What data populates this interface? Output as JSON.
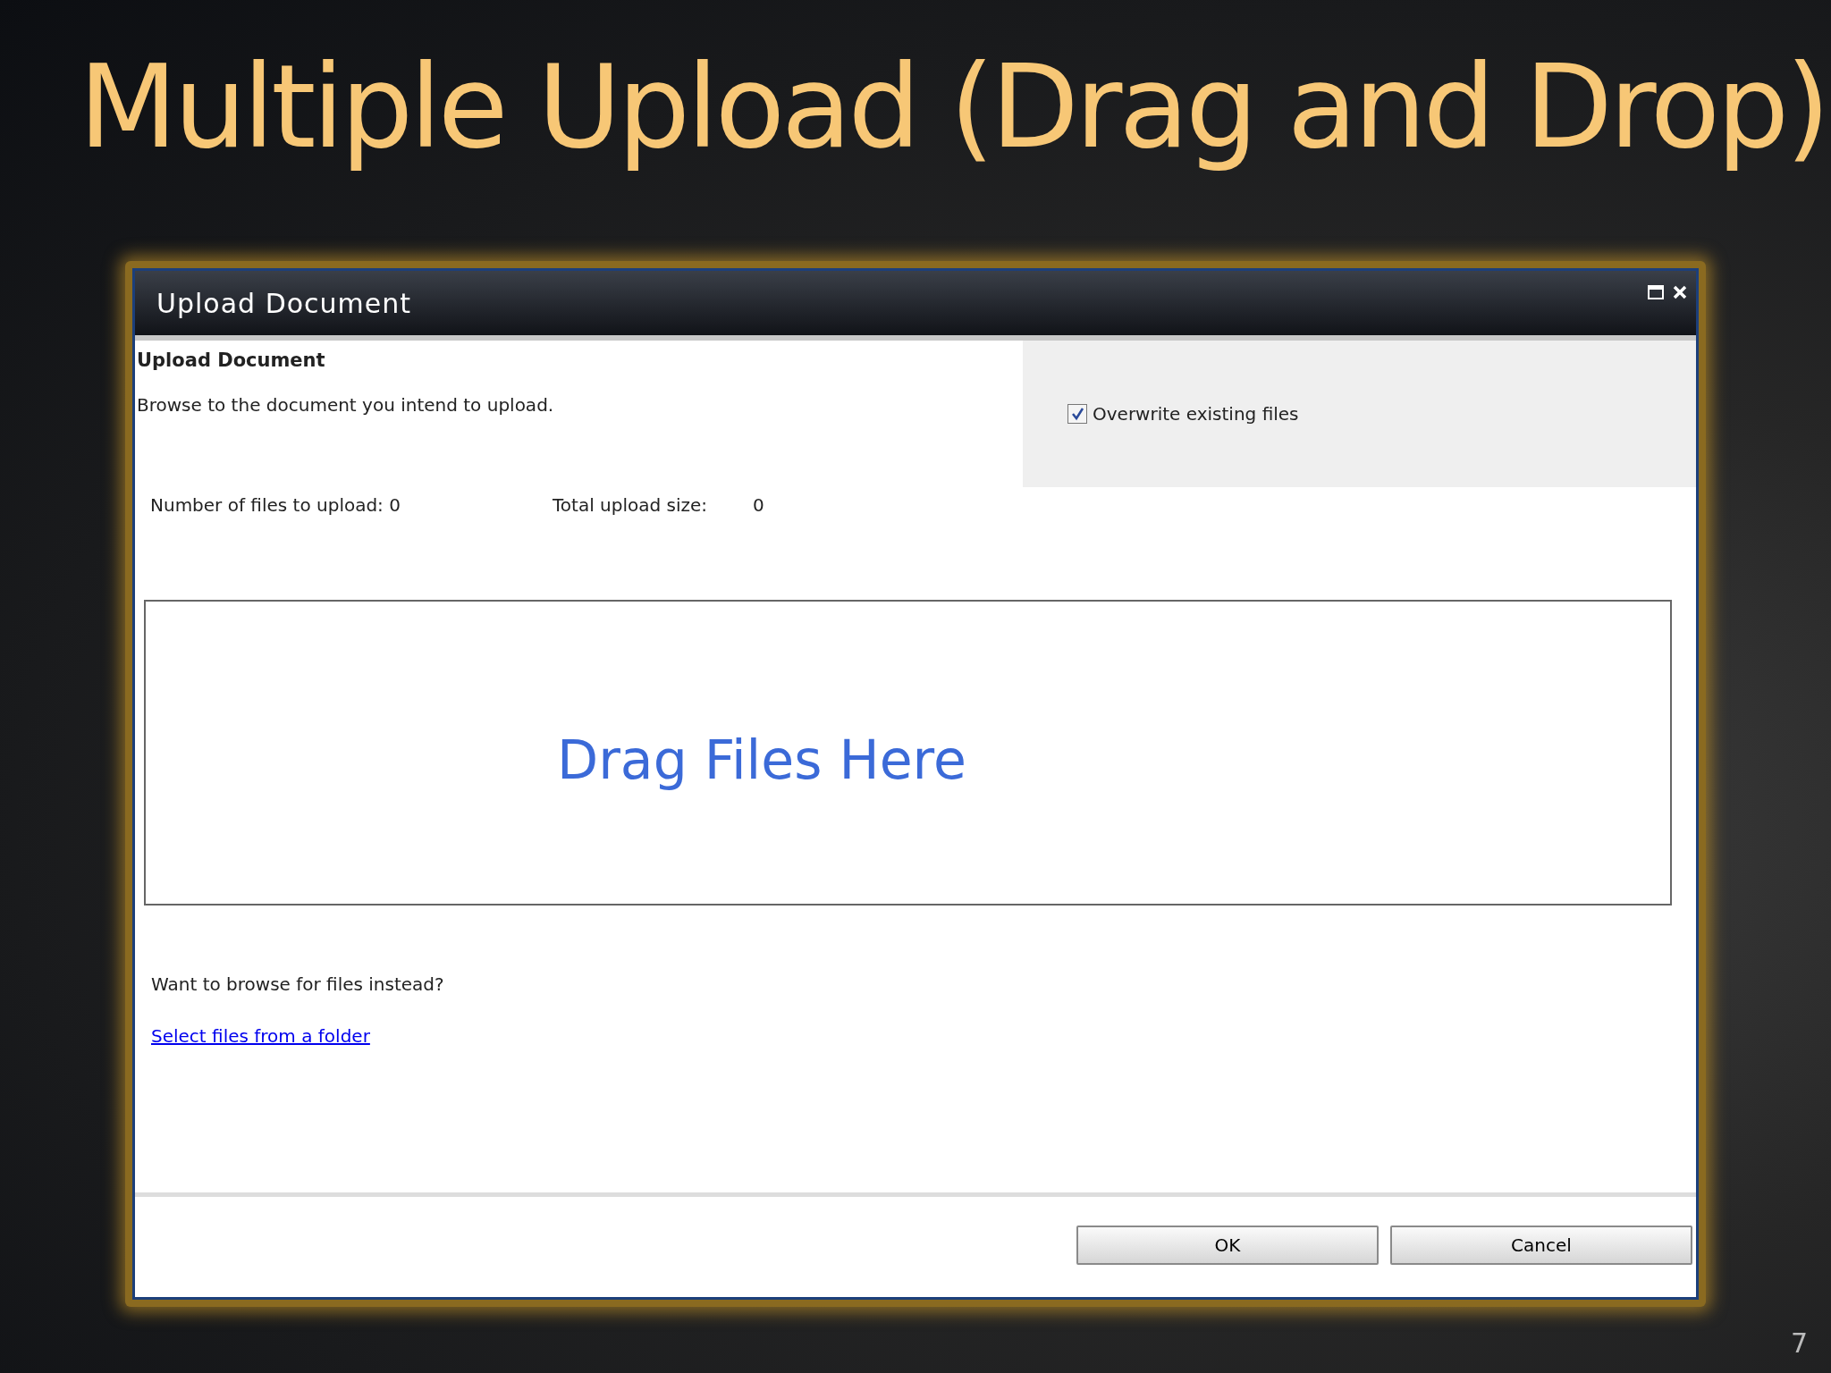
{
  "slide": {
    "title": "Multiple Upload (Drag and Drop)",
    "page_number": "7"
  },
  "dialog": {
    "title": "Upload Document",
    "heading": "Upload Document",
    "description": "Browse to the document you intend to upload.",
    "overwrite": {
      "label": "Overwrite existing files",
      "checked": true
    },
    "file_count": "Number of files to upload: 0",
    "size_label": "Total upload size:",
    "size_value": "0",
    "drop_zone": "Drag Files Here",
    "browse_prompt": "Want to browse for files instead?",
    "browse_link": "Select files from a folder",
    "buttons": [
      "OK",
      "Cancel"
    ]
  }
}
